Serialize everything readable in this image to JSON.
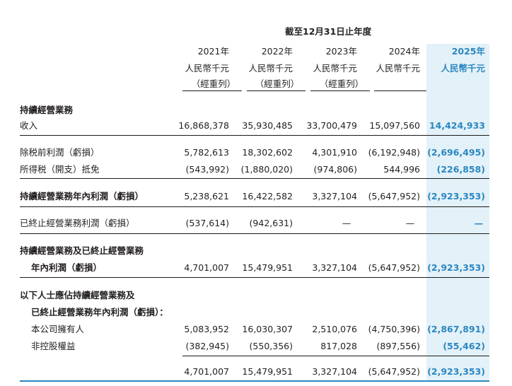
{
  "header": {
    "period": "截至12月31日止年度",
    "columns": [
      {
        "year": "2021年",
        "unit": "人民幣千元",
        "note": "（經重列）"
      },
      {
        "year": "2022年",
        "unit": "人民幣千元",
        "note": "（經重列）"
      },
      {
        "year": "2023年",
        "unit": "人民幣千元",
        "note": "（經重列）"
      },
      {
        "year": "2024年",
        "unit": "人民幣千元",
        "note": ""
      },
      {
        "year": "2025年",
        "unit": "人民幣千元",
        "note": ""
      }
    ]
  },
  "sections": {
    "continuing": "持續經營業務",
    "combined_line1": "持續經營業務及已終止經營業務",
    "attrib_line1": "以下人士應佔持續經營業務及",
    "attrib_line2": "已終止經營業務年內利潤（虧損）："
  },
  "rows": [
    {
      "label": "收入",
      "values": [
        "16,868,378",
        "35,930,485",
        "33,700,479",
        "15,097,560",
        "14,424,933"
      ]
    },
    {
      "label": "除税前利潤（虧損）",
      "values": [
        "5,782,613",
        "18,302,602",
        "4,301,910",
        "(6,192,948)",
        "(2,696,495)"
      ]
    },
    {
      "label": "所得税（開支）抵免",
      "values": [
        "(543,992)",
        "(1,880,020)",
        "(974,806)",
        "544,996",
        "(226,858)"
      ]
    },
    {
      "label": "持續經營業務年內利潤（虧損）",
      "values": [
        "5,238,621",
        "16,422,582",
        "3,327,104",
        "(5,647,952)",
        "(2,923,353)"
      ]
    },
    {
      "label": "已終止經營業務利潤（虧損）",
      "values": [
        "(537,614)",
        "(942,631)",
        "—",
        "—",
        "—"
      ]
    },
    {
      "label": "年內利潤（虧損）",
      "values": [
        "4,701,007",
        "15,479,951",
        "3,327,104",
        "(5,647,952)",
        "(2,923,353)"
      ]
    },
    {
      "label": "本公司擁有人",
      "values": [
        "5,083,952",
        "16,030,307",
        "2,510,076",
        "(4,750,396)",
        "(2,867,891)"
      ]
    },
    {
      "label": "非控股權益",
      "values": [
        "(382,945)",
        "(550,356)",
        "817,028",
        "(897,556)",
        "(55,462)"
      ]
    },
    {
      "label": "",
      "values": [
        "4,701,007",
        "15,479,951",
        "3,327,104",
        "(5,647,952)",
        "(2,923,353)"
      ]
    }
  ],
  "colors": {
    "accent": "#2b87c1",
    "highlight": "#e3f1f8",
    "text": "#231f20"
  }
}
